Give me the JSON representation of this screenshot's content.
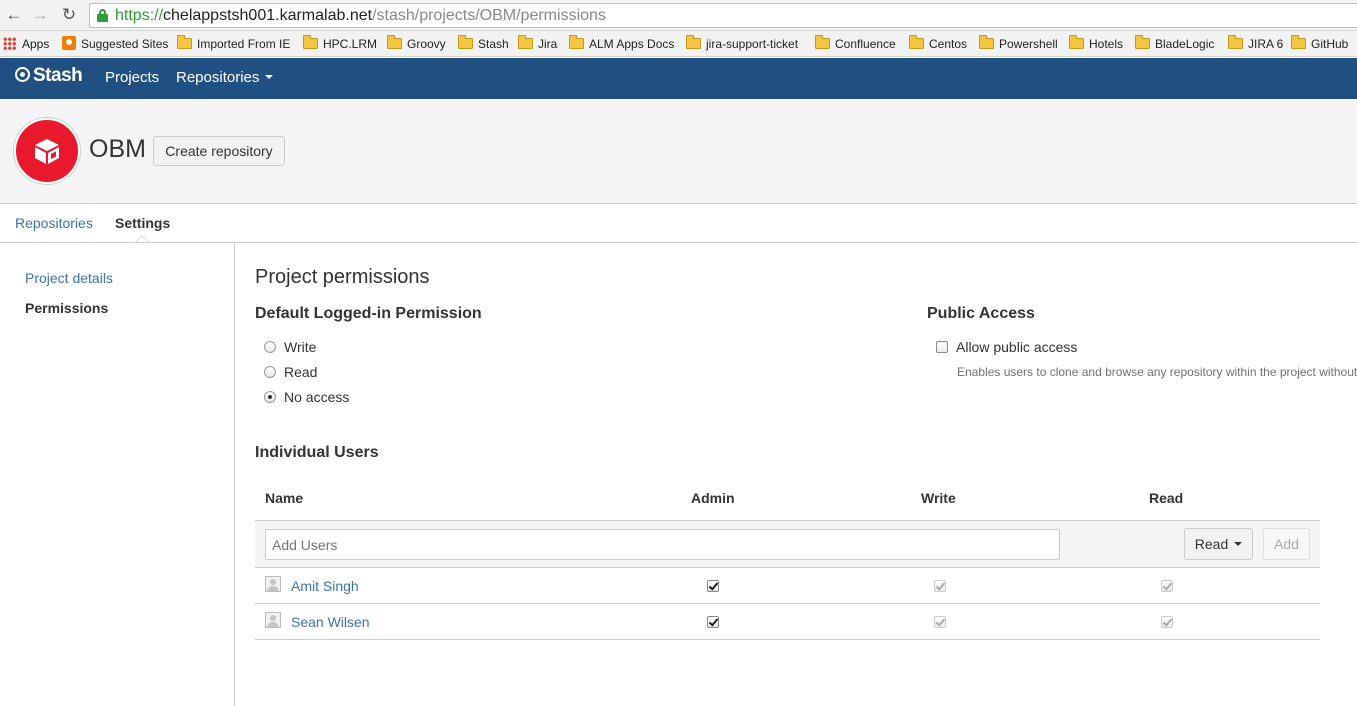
{
  "browser": {
    "url_scheme": "https://",
    "url_host": "chelappstsh001.karmalab.net",
    "url_path": "/stash/projects/OBM/permissions",
    "bookmarks": [
      "Apps",
      "Suggested Sites",
      "Imported From IE",
      "HPC.LRM",
      "Groovy",
      "Stash",
      "Jira",
      "ALM Apps Docs",
      "jira-support-ticket",
      "Confluence",
      "Centos",
      "Powershell",
      "Hotels",
      "BladeLogic",
      "JIRA 6",
      "GitHub"
    ]
  },
  "header": {
    "logo": "Stash",
    "nav_projects": "Projects",
    "nav_repositories": "Repositories",
    "bg_color": "#205081"
  },
  "project": {
    "name": "OBM",
    "create_repo_label": "Create repository",
    "avatar_color": "#e8192c"
  },
  "tabs": {
    "repositories": "Repositories",
    "settings": "Settings"
  },
  "sidebar": {
    "project_details": "Project details",
    "permissions": "Permissions"
  },
  "main": {
    "page_title": "Project permissions",
    "default_perm_title": "Default Logged-in Permission",
    "default_options": [
      {
        "label": "Write",
        "selected": false
      },
      {
        "label": "Read",
        "selected": false
      },
      {
        "label": "No access",
        "selected": true
      }
    ],
    "public_access_title": "Public Access",
    "public_access_label": "Allow public access",
    "public_access_checked": false,
    "public_access_desc": "Enables users to clone and browse any repository within the project without",
    "individual_users_title": "Individual Users",
    "columns": {
      "name": "Name",
      "admin": "Admin",
      "write": "Write",
      "read": "Read"
    },
    "add_users_placeholder": "Add Users",
    "permission_select": "Read",
    "add_label": "Add",
    "users": [
      {
        "name": "Amit Singh",
        "admin": true,
        "write": true,
        "read": true
      },
      {
        "name": "Sean Wilsen",
        "admin": true,
        "write": true,
        "read": true
      }
    ]
  }
}
